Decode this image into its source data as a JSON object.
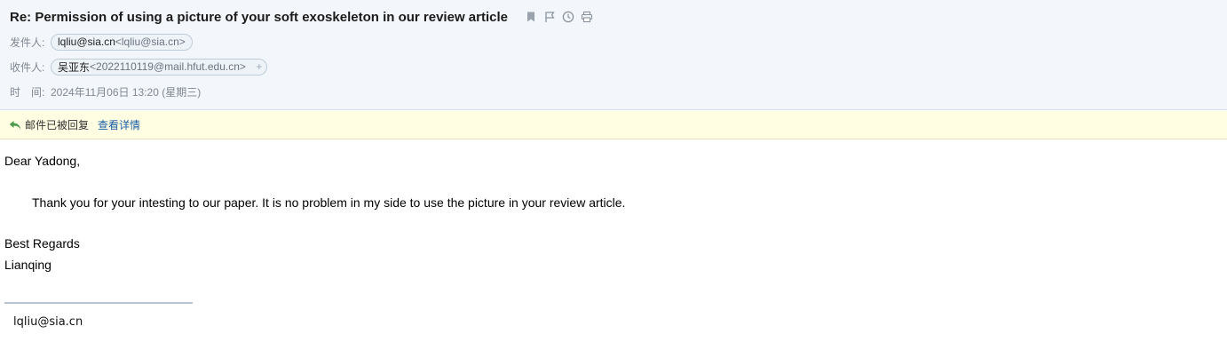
{
  "email": {
    "subject": "Re: Permission of using a picture of your soft exoskeleton in our review article",
    "subject_icons": [
      "bookmark-icon",
      "flag-icon",
      "clock-icon",
      "print-icon"
    ],
    "sender": {
      "label": "发件人:",
      "name": "lqliu@sia.cn",
      "email": "<lqliu@sia.cn>"
    },
    "recipient": {
      "label": "收件人:",
      "name": "吴亚东",
      "email": "<2022110119@mail.hfut.edu.cn>",
      "add_symbol": "+"
    },
    "time": {
      "label": "时　间:",
      "value": "2024年11月06日 13:20 (星期三)"
    }
  },
  "notice": {
    "text": "邮件已被回复",
    "link": "查看详情",
    "icon": "reply-icon"
  },
  "body": {
    "greeting": "Dear Yadong,",
    "paragraph": "Thank you for your intesting to our paper. It is no problem in my side to use the picture in your review article.",
    "closing": "Best Regards",
    "name": "Lianqing"
  },
  "signature": {
    "email": "lqliu@sia.cn"
  },
  "colors": {
    "header_bg": "#f3f6fa",
    "notice_bg": "#fffde2",
    "link": "#1a5fa8",
    "pill_border": "#bdccd9"
  }
}
